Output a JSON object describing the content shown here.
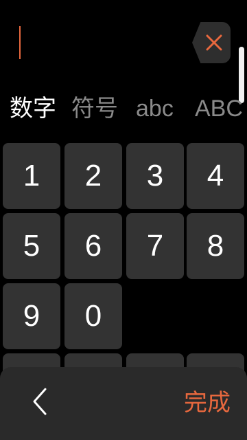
{
  "input": {
    "value": ""
  },
  "tabs": [
    {
      "label": "数字",
      "active": true
    },
    {
      "label": "符号",
      "active": false
    },
    {
      "label": "abc",
      "active": false
    },
    {
      "label": "ABC",
      "active": false
    }
  ],
  "keys": [
    "1",
    "2",
    "3",
    "4",
    "5",
    "6",
    "7",
    "8",
    "9",
    "0"
  ],
  "bottom": {
    "done_label": "完成"
  },
  "colors": {
    "accent": "#e8683e",
    "key_bg": "#333333",
    "background": "#000000"
  },
  "icons": {
    "delete": "delete-x-icon",
    "back": "chevron-left-icon"
  }
}
